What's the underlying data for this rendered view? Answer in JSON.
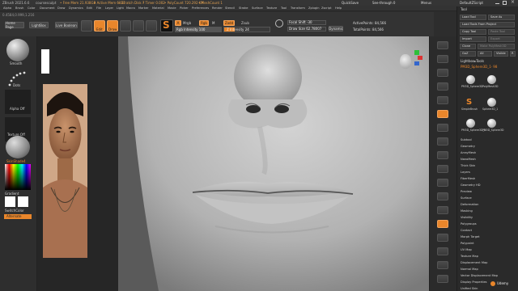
{
  "titlebar": {
    "app": "ZBrush 2021.6.6",
    "file": "coursesculpt",
    "free_mem": "• Free Mem 21.938GB",
    "active_mem": "• Active Mem 6327",
    "scratch": "• Scratch Disk 7",
    "timer": "• Timer 0.002",
    "poly": "• PolyCount 720.292 KP",
    "mesh": "• MeshCount 1",
    "quicksave": "QuickSave",
    "seethrough": "See-through 0",
    "menus": "Menus",
    "defaultscript": "DefaultZScript"
  },
  "menubar": [
    "Alpha",
    "Brush",
    "Color",
    "Document",
    "Draw",
    "Dynamics",
    "Edit",
    "File",
    "Layer",
    "Light",
    "Macro",
    "Marker",
    "Material",
    "Movie",
    "Picker",
    "Preferences",
    "Render",
    "Stencil",
    "Stroke",
    "Surface",
    "Texture",
    "Tool",
    "Transform",
    "Zplugin",
    "Zscript",
    "Help"
  ],
  "subbar": {
    "coords": "0.4584,0.999,1.216"
  },
  "topshelf": {
    "home": "Home Page",
    "lightbox": "LightBox",
    "live_boolean": "Live Boolean",
    "edit": "Edit",
    "draw": "Draw",
    "a_label": "A",
    "mrgb": "Mrgb",
    "rgb": "Rgb",
    "m": "M",
    "zadd": "Zadd",
    "zsub": "Zsub",
    "rgb_intensity": "Rgb Intensity 100",
    "z_intensity": "Z Intensity 24",
    "focal_shift": "Focal Shift -30",
    "draw_size": "Draw Size 62.78007",
    "dynamic": "Dynamic",
    "active_points": "ActivePoints: 84,566",
    "total_points": "TotalPoints: 84,566"
  },
  "lefttray": {
    "brush": "Smooth",
    "stroke": "Dots",
    "alpha": "Alpha Off",
    "texture": "Texture Off",
    "material": "SkinShade4",
    "gradient": "Gradient",
    "switch_color": "SwitchColor",
    "alternate": "Alternate"
  },
  "rightpanel": {
    "header": "Tool",
    "load_tool": "Load Tool",
    "save_as": "Save As",
    "load_tools_from_project": "Load Tools From Project",
    "copy_tool": "Copy Tool",
    "paste_tool": "Paste Tool",
    "import": "Import",
    "export": "Export",
    "clone": "Clone",
    "make_polymesh": "Make PolyMesh3D",
    "goz": "GoZ",
    "all": "All",
    "visible": "Visible",
    "r": "R",
    "lightbox_tools": "Lightbox▸Tools",
    "current_tool": "PM3D_Sphere3D_1· 98",
    "thumbs": [
      "PM3D_Sphere3D",
      "PolyMesh3D",
      "SimpleBrush",
      "Sphere3D_1",
      "PM3D_Sphere3D_1",
      "PM3D_Sphere3D"
    ],
    "subpalettes": [
      "Subtool",
      "Geometry",
      "ArrayMesh",
      "NanoMesh",
      "Thick Skin",
      "Layers",
      "FiberMesh",
      "Geometry HD",
      "Preview",
      "Surface",
      "Deformation",
      "Masking",
      "Visibility",
      "Polygroups",
      "Contact",
      "Morph Target",
      "Polypaint",
      "UV Map",
      "Texture Map",
      "Displacement Map",
      "Normal Map",
      "Vector Displacement Map",
      "Display Properties",
      "Unified Skin"
    ]
  },
  "watermark": "Udemy",
  "colors": {
    "accent": "#e9862b",
    "skin": "#b9875f"
  }
}
